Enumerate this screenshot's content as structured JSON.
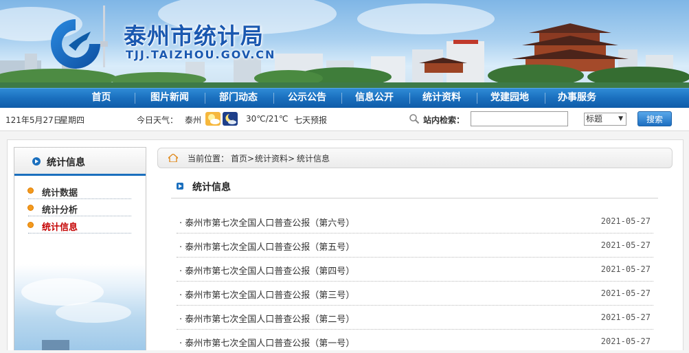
{
  "header": {
    "site_title": "泰州市统计局",
    "site_domain": "TJJ.TAIZHOU.GOV.CN"
  },
  "nav": {
    "items": [
      {
        "label": "首页"
      },
      {
        "label": "图片新闻"
      },
      {
        "label": "部门动态"
      },
      {
        "label": "公示公告"
      },
      {
        "label": "信息公开"
      },
      {
        "label": "统计资料"
      },
      {
        "label": "党建园地"
      },
      {
        "label": "办事服务"
      }
    ]
  },
  "infobar": {
    "date": "121年5月27日",
    "weekday": "星期四",
    "weather_label": "今日天气：",
    "city": "泰州",
    "weather_icons": [
      "sun-cloud-icon",
      "moon-cloud-icon"
    ],
    "temperature": "30℃/21℃",
    "forecast_link": "七天预报",
    "search_label": "站内检索：",
    "search_value": "",
    "search_type": "标题",
    "search_button": "搜索"
  },
  "sidebar": {
    "title": "统计信息",
    "items": [
      {
        "label": "统计数据",
        "active": false
      },
      {
        "label": "统计分析",
        "active": false
      },
      {
        "label": "统计信息",
        "active": true
      }
    ]
  },
  "breadcrumb": {
    "prefix": "当前位置：",
    "parts": [
      "首页>",
      "统计资料>",
      "统计信息"
    ]
  },
  "content": {
    "title": "统计信息",
    "items": [
      {
        "title": "· 泰州市第七次全国人口普查公报（第六号）",
        "date": "2021-05-27"
      },
      {
        "title": "· 泰州市第七次全国人口普查公报（第五号）",
        "date": "2021-05-27"
      },
      {
        "title": "· 泰州市第七次全国人口普查公报（第四号）",
        "date": "2021-05-27"
      },
      {
        "title": "· 泰州市第七次全国人口普查公报（第三号）",
        "date": "2021-05-27"
      },
      {
        "title": "· 泰州市第七次全国人口普查公报（第二号）",
        "date": "2021-05-27"
      },
      {
        "title": "· 泰州市第七次全国人口普查公报（第一号）",
        "date": "2021-05-27"
      }
    ]
  },
  "colors": {
    "brand_blue": "#1a6fbe",
    "active_red": "#c40000",
    "bullet_orange": "#f39a1e"
  }
}
